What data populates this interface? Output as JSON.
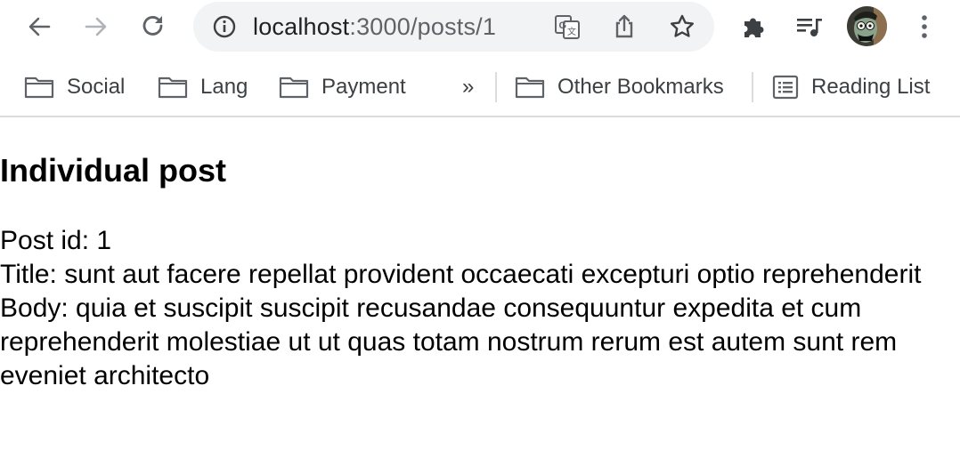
{
  "browser": {
    "url_host": "localhost",
    "url_path": ":3000/posts/1",
    "bookmarks": [
      {
        "label": "Social"
      },
      {
        "label": "Lang"
      },
      {
        "label": "Payment"
      }
    ],
    "more_label": "»",
    "other_bookmarks": "Other Bookmarks",
    "reading_list": "Reading List"
  },
  "page": {
    "heading": "Individual post",
    "post_id_line": "Post id: 1",
    "title_line": "Title: sunt aut facere repellat provident occaecati excepturi optio reprehenderit",
    "body_line": "Body: quia et suscipit suscipit recusandae consequuntur expedita et cum reprehenderit molestiae ut ut quas totam nostrum rerum est autem sunt rem eveniet architecto"
  },
  "colors": {
    "icon": "#5f6368",
    "icon_disabled": "#b0b3b7",
    "omnibox_bg": "#f1f3f4"
  }
}
